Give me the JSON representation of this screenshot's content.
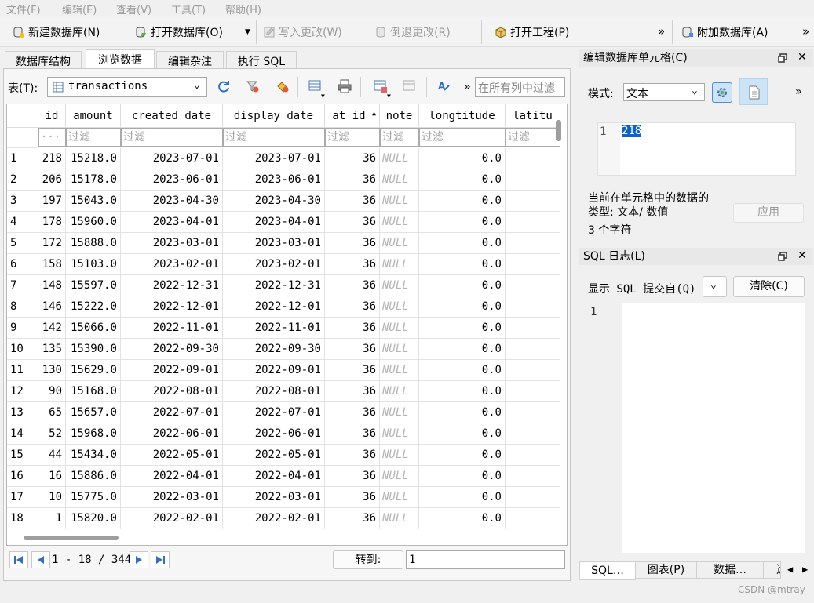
{
  "menu": [
    "文件(F)",
    "编辑(E)",
    "查看(V)",
    "工具(T)",
    "帮助(H)"
  ],
  "toolbar": {
    "new_db": "新建数据库(N)",
    "open_db": "打开数据库(O)",
    "write_changes": "写入更改(W)",
    "revert_changes": "倒退更改(R)",
    "open_project": "打开工程(P)",
    "attach_db": "附加数据库(A)",
    "overflow": "»"
  },
  "tabs": [
    "数据库结构",
    "浏览数据",
    "编辑杂注",
    "执行 SQL"
  ],
  "browse": {
    "table_label": "表(T):",
    "table_name": "transactions",
    "filter_all_placeholder": "在所有列中过滤",
    "overflow": "»",
    "filter_placeholder": "过滤",
    "filter_first": "···",
    "sort_indicator": "▲",
    "columns": [
      "id",
      "amount",
      "created_date",
      "display_date",
      "at_id",
      "note",
      "longtitude",
      "latitu"
    ],
    "rows": [
      [
        "1",
        "218",
        "15218.0",
        "2023-07-01",
        "2023-07-01",
        "36",
        "NULL",
        "0.0"
      ],
      [
        "2",
        "206",
        "15178.0",
        "2023-06-01",
        "2023-06-01",
        "36",
        "NULL",
        "0.0"
      ],
      [
        "3",
        "197",
        "15043.0",
        "2023-04-30",
        "2023-04-30",
        "36",
        "NULL",
        "0.0"
      ],
      [
        "4",
        "178",
        "15960.0",
        "2023-04-01",
        "2023-04-01",
        "36",
        "NULL",
        "0.0"
      ],
      [
        "5",
        "172",
        "15888.0",
        "2023-03-01",
        "2023-03-01",
        "36",
        "NULL",
        "0.0"
      ],
      [
        "6",
        "158",
        "15103.0",
        "2023-02-01",
        "2023-02-01",
        "36",
        "NULL",
        "0.0"
      ],
      [
        "7",
        "148",
        "15597.0",
        "2022-12-31",
        "2022-12-31",
        "36",
        "NULL",
        "0.0"
      ],
      [
        "8",
        "146",
        "15222.0",
        "2022-12-01",
        "2022-12-01",
        "36",
        "NULL",
        "0.0"
      ],
      [
        "9",
        "142",
        "15066.0",
        "2022-11-01",
        "2022-11-01",
        "36",
        "NULL",
        "0.0"
      ],
      [
        "10",
        "135",
        "15390.0",
        "2022-09-30",
        "2022-09-30",
        "36",
        "NULL",
        "0.0"
      ],
      [
        "11",
        "130",
        "15629.0",
        "2022-09-01",
        "2022-09-01",
        "36",
        "NULL",
        "0.0"
      ],
      [
        "12",
        "90",
        "15168.0",
        "2022-08-01",
        "2022-08-01",
        "36",
        "NULL",
        "0.0"
      ],
      [
        "13",
        "65",
        "15657.0",
        "2022-07-01",
        "2022-07-01",
        "36",
        "NULL",
        "0.0"
      ],
      [
        "14",
        "52",
        "15968.0",
        "2022-06-01",
        "2022-06-01",
        "36",
        "NULL",
        "0.0"
      ],
      [
        "15",
        "44",
        "15434.0",
        "2022-05-01",
        "2022-05-01",
        "36",
        "NULL",
        "0.0"
      ],
      [
        "16",
        "16",
        "15886.0",
        "2022-04-01",
        "2022-04-01",
        "36",
        "NULL",
        "0.0"
      ],
      [
        "17",
        "10",
        "15775.0",
        "2022-03-01",
        "2022-03-01",
        "36",
        "NULL",
        "0.0"
      ],
      [
        "18",
        "1",
        "15820.0",
        "2022-02-01",
        "2022-02-01",
        "36",
        "NULL",
        "0.0"
      ]
    ],
    "pagination": {
      "text": "1 - 18 / 344",
      "goto_label": "转到:",
      "goto_value": "1"
    }
  },
  "edit_cell": {
    "title": "编辑数据库单元格(C)",
    "mode_label": "模式:",
    "mode_value": "文本",
    "overflow": "»",
    "line_number": "1",
    "cell_value": "218",
    "type_line1": "当前在单元格中的数据的",
    "type_line2": "类型: 文本/ 数值",
    "char_count": "3 个字符",
    "apply_button": "应用"
  },
  "sql_log": {
    "title": "SQL 日志(L)",
    "show_label": "显示 SQL 提交自(Q)",
    "clear_button": "清除(C)",
    "line_number": "1"
  },
  "bottom_tabs": [
    "SQL…",
    "图表(P)",
    "数据…",
    "远"
  ],
  "watermark": "CSDN @mtray"
}
